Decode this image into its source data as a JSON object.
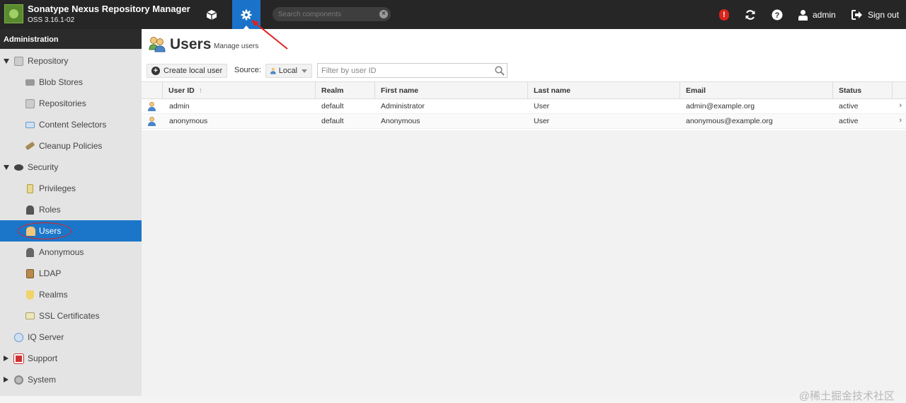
{
  "header": {
    "app_title": "Sonatype Nexus Repository Manager",
    "version": "OSS 3.16.1-02",
    "search": {
      "placeholder": "Search components",
      "value": ""
    },
    "user": "admin",
    "sign_out": "Sign out",
    "alert_count": "!",
    "icons": [
      "browse-cube-icon",
      "admin-gear-icon",
      "refresh-icon",
      "help-icon",
      "user-icon",
      "sign-out-icon"
    ]
  },
  "sidebar": {
    "title": "Administration",
    "items": [
      {
        "label": "Repository",
        "expanded": true,
        "level": 0,
        "icon": "repository-icon"
      },
      {
        "label": "Blob Stores",
        "level": 1,
        "icon": "blob-store-icon"
      },
      {
        "label": "Repositories",
        "level": 1,
        "icon": "repositories-icon"
      },
      {
        "label": "Content Selectors",
        "level": 1,
        "icon": "content-selector-icon"
      },
      {
        "label": "Cleanup Policies",
        "level": 1,
        "icon": "broom-icon"
      },
      {
        "label": "Security",
        "expanded": true,
        "level": 0,
        "icon": "security-eye-icon"
      },
      {
        "label": "Privileges",
        "level": 1,
        "icon": "privileges-icon"
      },
      {
        "label": "Roles",
        "level": 1,
        "icon": "roles-icon"
      },
      {
        "label": "Users",
        "level": 1,
        "icon": "users-icon",
        "active": true
      },
      {
        "label": "Anonymous",
        "level": 1,
        "icon": "anonymous-icon"
      },
      {
        "label": "LDAP",
        "level": 1,
        "icon": "ldap-book-icon"
      },
      {
        "label": "Realms",
        "level": 1,
        "icon": "realms-shield-icon"
      },
      {
        "label": "SSL Certificates",
        "level": 1,
        "icon": "ssl-certificate-icon"
      },
      {
        "label": "IQ Server",
        "level": 0,
        "icon": "iq-server-icon"
      },
      {
        "label": "Support",
        "expanded": false,
        "level": 0,
        "icon": "support-icon"
      },
      {
        "label": "System",
        "expanded": false,
        "level": 0,
        "icon": "system-gear-icon"
      }
    ]
  },
  "main": {
    "title": "Users",
    "subtitle": "Manage users",
    "create_button": "Create local user",
    "source_label": "Source:",
    "source_value": "Local",
    "filter_placeholder": "Filter by user ID",
    "columns": [
      "User ID",
      "Realm",
      "First name",
      "Last name",
      "Email",
      "Status"
    ],
    "sort_indicator": "↑",
    "rows": [
      {
        "user_id": "admin",
        "realm": "default",
        "first_name": "Administrator",
        "last_name": "User",
        "email": "admin@example.org",
        "status": "active"
      },
      {
        "user_id": "anonymous",
        "realm": "default",
        "first_name": "Anonymous",
        "last_name": "User",
        "email": "anonymous@example.org",
        "status": "active"
      }
    ]
  },
  "watermark": "@稀土掘金技术社区",
  "colors": {
    "topbar": "#262626",
    "accent": "#1b76c9",
    "annotation": "#dd2222",
    "sidebar": "#e4e4e4"
  }
}
